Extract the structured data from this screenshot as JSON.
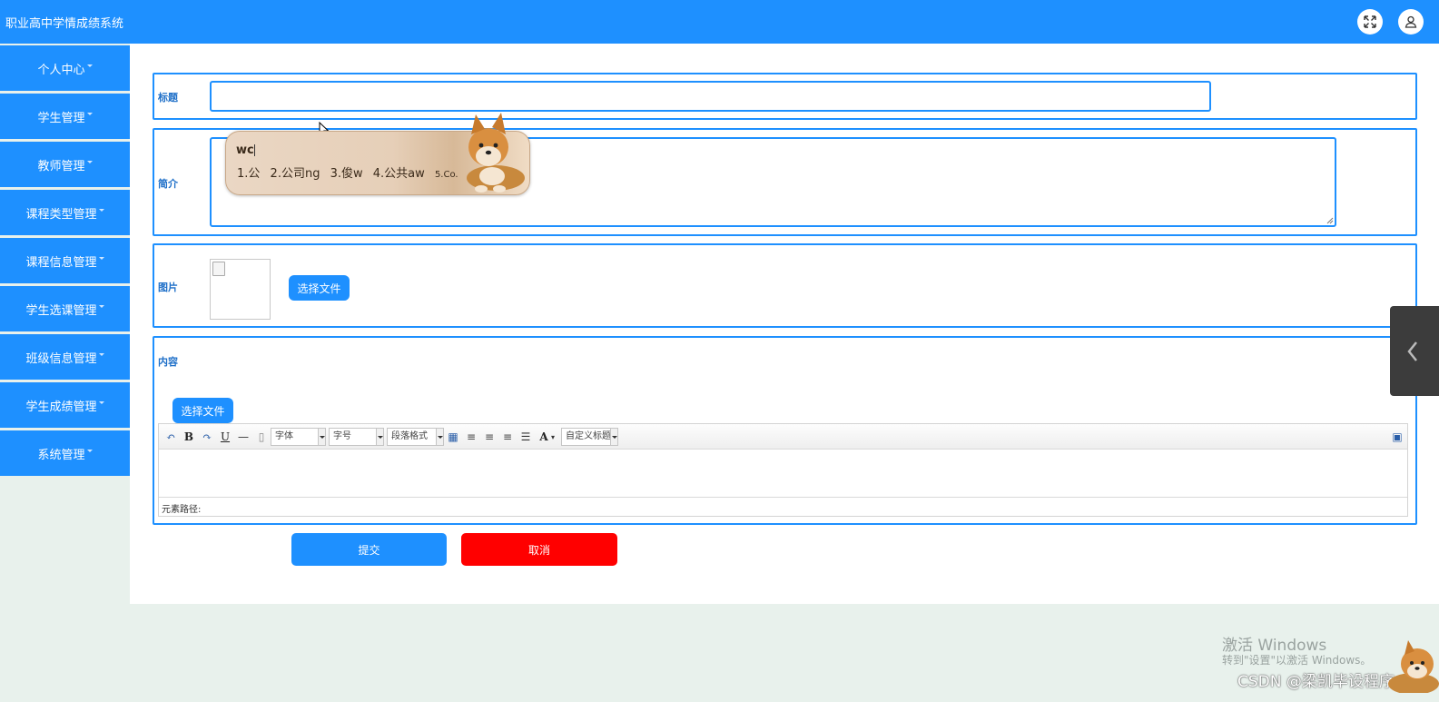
{
  "header": {
    "title": "职业高中学情成绩系统",
    "fullscreen_icon": "fullscreen-icon",
    "user_icon": "user-icon"
  },
  "sidebar": {
    "items": [
      {
        "label": "个人中心"
      },
      {
        "label": "学生管理"
      },
      {
        "label": "教师管理"
      },
      {
        "label": "课程类型管理"
      },
      {
        "label": "课程信息管理"
      },
      {
        "label": "学生选课管理"
      },
      {
        "label": "班级信息管理"
      },
      {
        "label": "学生成绩管理"
      },
      {
        "label": "系统管理"
      }
    ]
  },
  "form": {
    "title_label": "标题",
    "title_value": "",
    "intro_label": "简介",
    "intro_value": "",
    "image_label": "图片",
    "image_button": "选择文件",
    "content_label": "内容",
    "content_button": "选择文件",
    "submit_label": "提交",
    "cancel_label": "取消"
  },
  "editor": {
    "font_select": "字体",
    "size_select": "字号",
    "paragraph_select": "段落格式",
    "custom_title_select": "自定义标题",
    "path_label": "元素路径:"
  },
  "ime": {
    "input_code": "wc",
    "candidates": [
      "1.公",
      "2.公司ng",
      "3.俊w",
      "4.公共aw",
      "5.Co."
    ]
  },
  "watermark": {
    "line1": "激活 Windows",
    "line2": "转到\"设置\"以激活 Windows。",
    "csdn": "CSDN @梁凯毕设程序"
  },
  "colors": {
    "primary": "#1e90ff",
    "cancel": "#ff0000",
    "background": "#e8f1ec"
  }
}
